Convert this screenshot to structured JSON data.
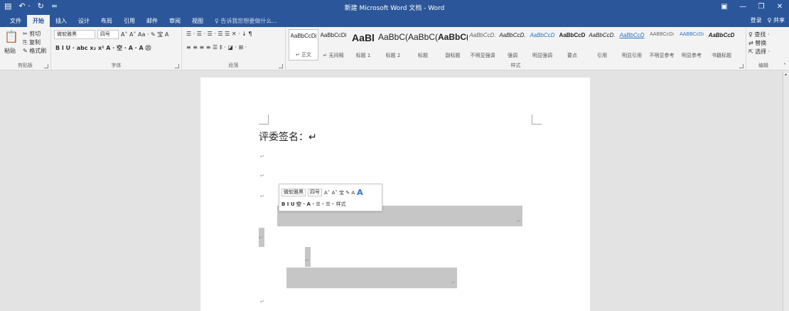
{
  "window": {
    "title": "新建 Microsoft Word 文档 - Word",
    "qat": {
      "save_icon": "save-icon",
      "undo": "↶ ·",
      "redo": "↻",
      "customize": "="
    },
    "controls": {
      "ribbon_display": "▣",
      "minimize": "—",
      "restore": "❐",
      "close": "✕"
    }
  },
  "tabs": {
    "items": [
      "文件",
      "开始",
      "插入",
      "设计",
      "布局",
      "引用",
      "邮件",
      "审阅",
      "视图"
    ],
    "active": "开始",
    "tell_me": "♀ 告诉我您想要做什么...",
    "signin": "登录",
    "share": "♀ 共享"
  },
  "ribbon": {
    "clipboard": {
      "label": "剪贴板",
      "paste": "粘贴",
      "cut": "✂ 剪切",
      "copy": "⎘ 复制",
      "format_painter": "✎ 格式刷"
    },
    "font": {
      "label": "字体",
      "font_name": "微软雅黑",
      "font_size": "四号",
      "row1_extra": "A˄ A˅ Aa · ✎ 宝 A",
      "row2": "B I U · abc x₂ x² A · 空 · A · A ㊂"
    },
    "paragraph": {
      "label": "段落",
      "row1": "☰ · ☰ · ☰ · ☰ ☰ ✕ · ↓ ¶",
      "row2": "≡ ≡ ≡ ≡ ☰ ‡ · ◪ · ⊞ ·"
    },
    "styles": {
      "label": "样式",
      "items": [
        {
          "preview": "AaBbCcDi",
          "name": "↵ 正文"
        },
        {
          "preview": "AaBbCcDi",
          "name": "↵ 无间隔"
        },
        {
          "preview": "AaBl",
          "name": "标题 1"
        },
        {
          "preview": "AaBbC(",
          "name": "标题 2"
        },
        {
          "preview": "AaBbC(",
          "name": "标题"
        },
        {
          "preview": "AaBbC(",
          "name": "副标题"
        },
        {
          "preview": "AaBbCcD.",
          "name": "不明显强调"
        },
        {
          "preview": "AaBbCcD.",
          "name": "强调"
        },
        {
          "preview": "AaBbCcD",
          "name": "明显强调"
        },
        {
          "preview": "AaBbCcD",
          "name": "要点"
        },
        {
          "preview": "AaBbCcD.",
          "name": "引用"
        },
        {
          "preview": "AaBbCcD",
          "name": "明显引用"
        },
        {
          "preview": "AABBCcDi",
          "name": "不明显参考"
        },
        {
          "preview": "AABBCcDi",
          "name": "明显参考"
        },
        {
          "preview": "AaBbCcD",
          "name": "书籍标题"
        }
      ]
    },
    "editing": {
      "label": "编辑",
      "find": "♀ 查找 ·",
      "replace": "⇄ 替换",
      "select": "⇱ 选择 ·"
    }
  },
  "document": {
    "title_line": "评委签名：↵",
    "pilcrow": "↵"
  },
  "mini_toolbar": {
    "font_name": "微软雅黑",
    "font_size": "四号",
    "row1_extra": "A˄ A˅ 宝 ✎ A",
    "row2": "B I U 空 · A · ☰ · ☰ ·",
    "styles_label": "样式"
  },
  "colors": {
    "accent": "#2b579a",
    "ribbon_bg": "#f3f3f3",
    "canvas": "#e3e3e3",
    "shade": "#c6c6c6"
  }
}
